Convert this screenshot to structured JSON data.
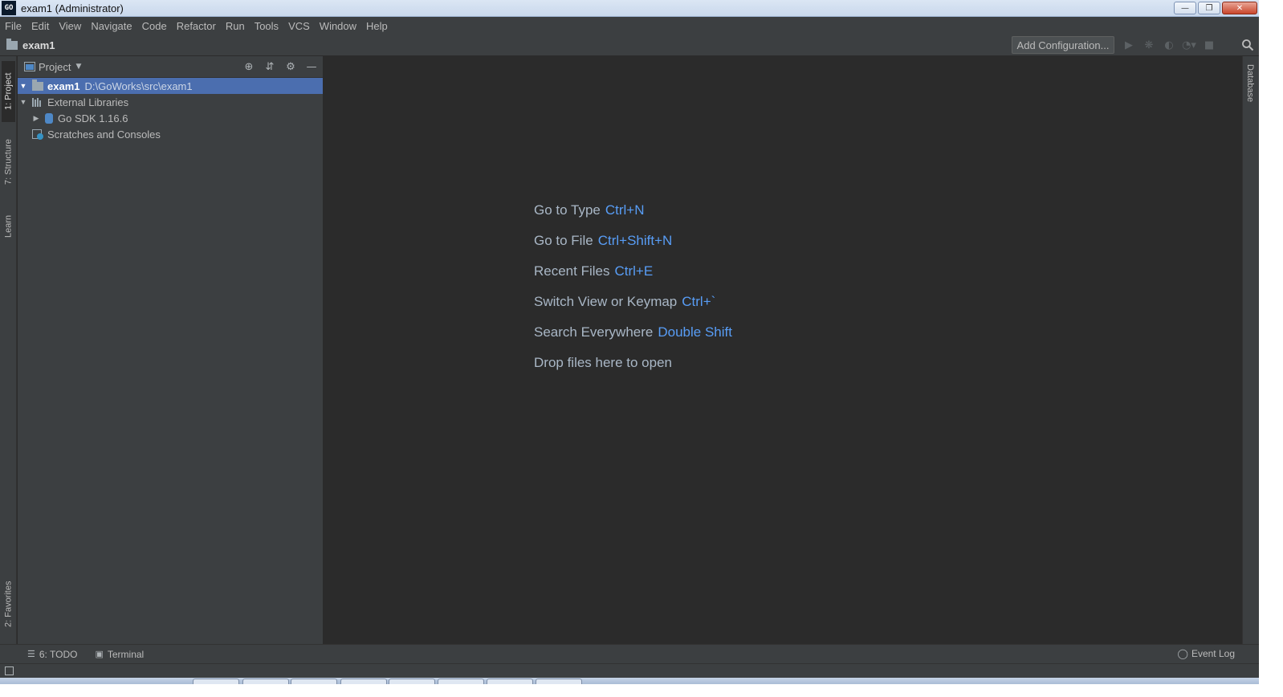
{
  "window": {
    "title": "exam1 (Administrator)",
    "app_icon_text": "GO",
    "controls": [
      "minimize",
      "restore",
      "close"
    ]
  },
  "menu": {
    "items": [
      "File",
      "Edit",
      "View",
      "Navigate",
      "Code",
      "Refactor",
      "Run",
      "Tools",
      "VCS",
      "Window",
      "Help"
    ]
  },
  "navbar": {
    "project_name": "exam1",
    "add_configuration_label": "Add Configuration..."
  },
  "left_tabs": {
    "project": "1: Project",
    "structure": "7: Structure",
    "learn": "Learn",
    "favorites": "2: Favorites"
  },
  "project_panel": {
    "title": "Project",
    "tree": [
      {
        "label": "exam1",
        "path": "D:\\GoWorks\\src\\exam1",
        "expanded": true,
        "selected": true
      },
      {
        "label": "External Libraries",
        "expanded": true
      },
      {
        "label": "Go SDK 1.16.6",
        "expanded": false
      },
      {
        "label": "Scratches and Consoles"
      }
    ]
  },
  "editor": {
    "hints": [
      {
        "text": "Go to Type",
        "key": "Ctrl+N"
      },
      {
        "text": "Go to File",
        "key": "Ctrl+Shift+N"
      },
      {
        "text": "Recent Files",
        "key": "Ctrl+E"
      },
      {
        "text": "Switch View or Keymap",
        "key": "Ctrl+`"
      },
      {
        "text": "Search Everywhere",
        "key": "Double Shift"
      },
      {
        "text": "Drop files here to open",
        "key": ""
      }
    ]
  },
  "right_tabs": {
    "database": "Database"
  },
  "bottom_bar": {
    "todo": "6: TODO",
    "terminal": "Terminal",
    "event_log": "Event Log"
  },
  "colors": {
    "background": "#2b2b2b",
    "panel": "#3c3f41",
    "selection": "#4b6eaf",
    "shortcut": "#589df6",
    "text": "#bbbbbb"
  }
}
